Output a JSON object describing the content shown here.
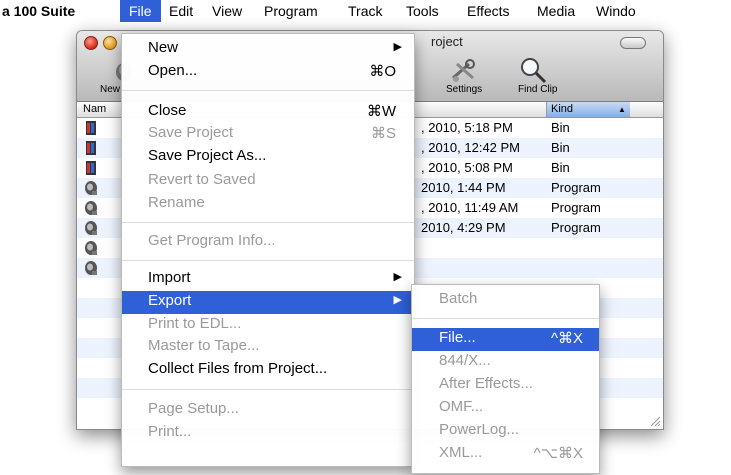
{
  "menubar": {
    "app_name": "a 100 Suite",
    "items": [
      "File",
      "Edit",
      "View",
      "Program",
      "Track",
      "Tools",
      "Effects",
      "Media",
      "Windo"
    ]
  },
  "window": {
    "title": "roject",
    "toolbar": {
      "new_label": "New",
      "settings_label": "Settings",
      "find_clip_label": "Find Clip"
    },
    "columns": {
      "name": "Nam",
      "kind": "Kind"
    },
    "rows": [
      {
        "date": ", 2010, 5:18 PM",
        "kind": "Bin",
        "icon": "bin-icon"
      },
      {
        "date": ", 2010, 12:42 PM",
        "kind": "Bin",
        "icon": "bin-icon"
      },
      {
        "date": ", 2010, 5:08 PM",
        "kind": "Bin",
        "icon": "bin-icon"
      },
      {
        "date": "2010, 1:44 PM",
        "kind": "Program",
        "icon": "program-icon"
      },
      {
        "date": ", 2010, 11:49 AM",
        "kind": "Program",
        "icon": "program-icon"
      },
      {
        "date": "2010, 4:29 PM",
        "kind": "Program",
        "icon": "program-icon"
      },
      {
        "date": "",
        "kind": "",
        "icon": "program-icon"
      },
      {
        "date": "",
        "kind": "",
        "icon": "program-icon"
      },
      {
        "date": "",
        "kind": "",
        "icon": ""
      },
      {
        "date": "",
        "kind": "",
        "icon": ""
      },
      {
        "date": "",
        "kind": "",
        "icon": ""
      },
      {
        "date": "",
        "kind": "",
        "icon": ""
      },
      {
        "date": "",
        "kind": "",
        "icon": ""
      },
      {
        "date": "",
        "kind": "",
        "icon": ""
      },
      {
        "date": "",
        "kind": "",
        "icon": ""
      }
    ]
  },
  "file_menu": {
    "new": {
      "label": "New"
    },
    "open": {
      "label": "Open...",
      "shortcut": "⌘O"
    },
    "close": {
      "label": "Close",
      "shortcut": "⌘W"
    },
    "save_project": {
      "label": "Save Project",
      "shortcut": "⌘S"
    },
    "save_project_as": {
      "label": "Save Project As..."
    },
    "revert_to_saved": {
      "label": "Revert to Saved"
    },
    "rename": {
      "label": "Rename"
    },
    "get_program_info": {
      "label": "Get Program Info..."
    },
    "import": {
      "label": "Import"
    },
    "export": {
      "label": "Export"
    },
    "print_to_edl": {
      "label": "Print to EDL..."
    },
    "master_to_tape": {
      "label": "Master to Tape..."
    },
    "collect_files": {
      "label": "Collect Files from Project..."
    },
    "page_setup": {
      "label": "Page Setup..."
    },
    "print": {
      "label": "Print..."
    }
  },
  "export_submenu": {
    "batch": {
      "label": "Batch"
    },
    "file": {
      "label": "File...",
      "shortcut": "^⌘X"
    },
    "844x": {
      "label": "844/X..."
    },
    "after_effects": {
      "label": "After Effects..."
    },
    "omf": {
      "label": "OMF..."
    },
    "powerlog": {
      "label": "PowerLog..."
    },
    "xml": {
      "label": "XML...",
      "shortcut": "^⌥⌘X"
    }
  },
  "colors": {
    "highlight": "#2f60d8",
    "disabled_text": "#9a9a9a",
    "alt_row": "#edf3fe"
  }
}
